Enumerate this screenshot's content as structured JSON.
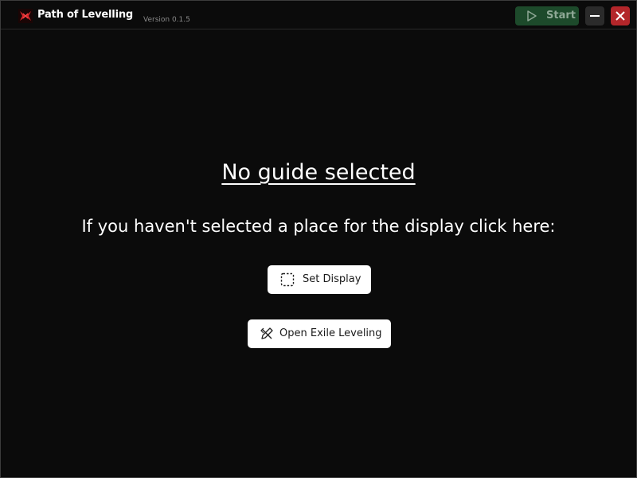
{
  "titlebar": {
    "app_title": "Path of Levelling",
    "version": "Version 0.1.5",
    "start_label": "Start",
    "logo_icon": "crossed-swords-logo-icon",
    "colors": {
      "start_bg": "#1d4a2b",
      "close_bg": "#b3262a",
      "minimize_bg": "#2b2b2b"
    }
  },
  "main": {
    "heading": "No guide selected",
    "instruction": "If you haven't selected a place for the display click here:",
    "set_display_label": "Set Display",
    "set_display_icon": "dashed-selection-icon",
    "open_exile_label": "Open Exile Leveling",
    "open_exile_icon": "crossed-pencil-icon"
  }
}
